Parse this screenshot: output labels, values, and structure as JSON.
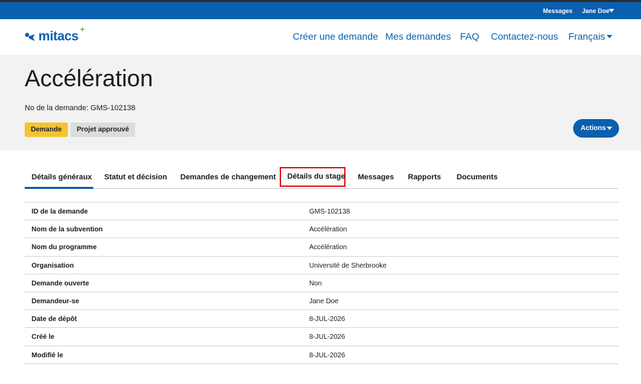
{
  "topbar": {
    "messages_label": "Messages",
    "user_label": "Jane Doe"
  },
  "header": {
    "logo_text": "mitacs",
    "logo_plus": "+",
    "nav": [
      {
        "label": "Créer une demande"
      },
      {
        "label": "Mes demandes"
      },
      {
        "label": "FAQ"
      },
      {
        "label": "Contactez-nous"
      },
      {
        "label": "Français"
      }
    ]
  },
  "hero": {
    "title": "Accélération",
    "request_number": "No de la demande: GMS-102138",
    "badges": [
      "Demande",
      "Projet approuvé"
    ],
    "actions_label": "Actions"
  },
  "tabs": [
    {
      "label": "Détails généraux",
      "active": true
    },
    {
      "label": "Statut et décision",
      "active": false
    },
    {
      "label": "Demandes de changement",
      "active": false
    },
    {
      "label": "Détails du stage",
      "active": false,
      "highlighted": true
    },
    {
      "label": "Messages",
      "active": false
    },
    {
      "label": "Rapports",
      "active": false
    },
    {
      "label": "Documents",
      "active": false
    }
  ],
  "details": [
    {
      "label": "ID de la demande",
      "value": "GMS-102138"
    },
    {
      "label": "Nom de la subvention",
      "value": "Accélération"
    },
    {
      "label": "Nom du programme",
      "value": "Accélération"
    },
    {
      "label": "Organisation",
      "value": "Université de Sherbrooke"
    },
    {
      "label": "Demande ouverte",
      "value": "Non"
    },
    {
      "label": "Demandeur-se",
      "value": "Jane Doe"
    },
    {
      "label": "Date de dépôt",
      "value": "8-JUL-2026"
    },
    {
      "label": "Créé le",
      "value": "8-JUL-2026"
    },
    {
      "label": "Modifié le",
      "value": "8-JUL-2026"
    }
  ],
  "colors": {
    "brand_blue": "#0b5fae",
    "badge_yellow": "#f4c331",
    "badge_gray": "#dcdcdc",
    "highlight_red": "#e0161e",
    "logo_green": "#6ab04c"
  }
}
